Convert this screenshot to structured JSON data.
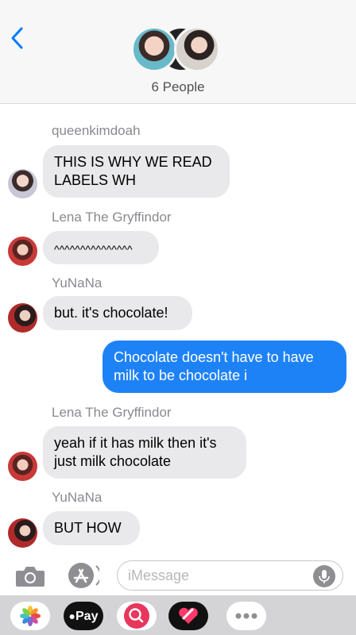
{
  "header": {
    "people_count": "6 People"
  },
  "messages": [
    {
      "sender": "queenkimdoah",
      "text_lines": [
        "THIS IS WHY WE READ",
        "LABELS WH"
      ],
      "direction": "incoming"
    },
    {
      "sender": "Lena The Gryffindor",
      "text_lines": [
        "^^^^^^^^^^^^^^^"
      ],
      "direction": "incoming"
    },
    {
      "sender": "YuNaNa",
      "text_lines": [
        "but. it's chocolate!"
      ],
      "direction": "incoming"
    },
    {
      "sender": "",
      "text_lines": [
        "Chocolate doesn't have to have",
        "milk to be chocolate i"
      ],
      "direction": "outgoing"
    },
    {
      "sender": "Lena The Gryffindor",
      "text_lines": [
        "yeah if it has milk then it's",
        "just milk chocolate"
      ],
      "direction": "incoming"
    },
    {
      "sender": "YuNaNa",
      "text_lines": [
        "BUT HOW"
      ],
      "direction": "incoming"
    }
  ],
  "input": {
    "placeholder": "iMessage",
    "value": ""
  },
  "drawer": {
    "apple_pay_label": "Pay"
  },
  "colors": {
    "outgoing_bubble": "#1e82f7",
    "incoming_bubble": "#e9e9eb",
    "accent": "#007aff"
  },
  "icons": [
    "back-chevron-icon",
    "camera-icon",
    "app-store-icon",
    "microphone-icon",
    "photos-icon",
    "apple-pay-icon",
    "search-images-icon",
    "digital-touch-icon",
    "more-icon"
  ]
}
